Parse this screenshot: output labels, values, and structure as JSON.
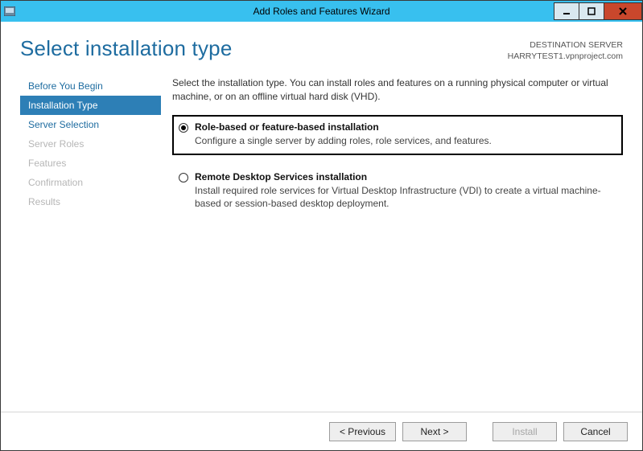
{
  "window": {
    "title": "Add Roles and Features Wizard"
  },
  "header": {
    "page_title": "Select installation type",
    "destination_label": "DESTINATION SERVER",
    "destination_value": "HARRYTEST1.vpnproject.com"
  },
  "nav": {
    "items": [
      {
        "label": "Before You Begin",
        "state": "link"
      },
      {
        "label": "Installation Type",
        "state": "active"
      },
      {
        "label": "Server Selection",
        "state": "link"
      },
      {
        "label": "Server Roles",
        "state": "disabled"
      },
      {
        "label": "Features",
        "state": "disabled"
      },
      {
        "label": "Confirmation",
        "state": "disabled"
      },
      {
        "label": "Results",
        "state": "disabled"
      }
    ]
  },
  "content": {
    "intro": "Select the installation type. You can install roles and features on a running physical computer or virtual machine, or on an offline virtual hard disk (VHD).",
    "options": [
      {
        "title": "Role-based or feature-based installation",
        "description": "Configure a single server by adding roles, role services, and features.",
        "selected": true
      },
      {
        "title": "Remote Desktop Services installation",
        "description": "Install required role services for Virtual Desktop Infrastructure (VDI) to create a virtual machine-based or session-based desktop deployment.",
        "selected": false
      }
    ]
  },
  "footer": {
    "previous": "< Previous",
    "next": "Next >",
    "install": "Install",
    "cancel": "Cancel"
  }
}
